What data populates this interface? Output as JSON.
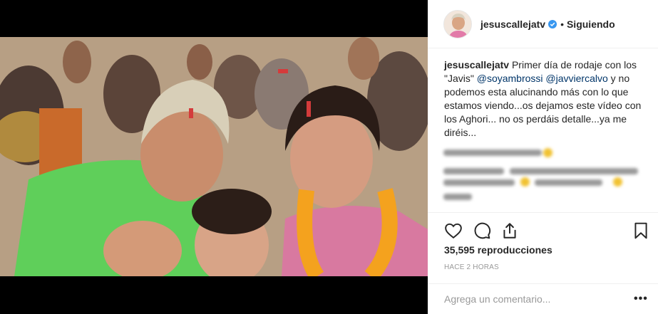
{
  "post": {
    "username": "jesuscallejatv",
    "follow_status": "Siguiendo",
    "separator": "•",
    "caption": {
      "username": "jesuscallejatv",
      "part1": " Primer día de rodaje con los \"Javis\" ",
      "mention1": "@soyambrossi",
      "mention2": "@javviercalvo",
      "part2": " y no podemos esta alucinando más con lo que estamos viendo...os dejamos este vídeo con los Aghori... no os perdáis detalle...ya me diréis..."
    },
    "views_label": "35,595 reproducciones",
    "time_label": "HACE 2 HORAS",
    "comment_placeholder": "Agrega un comentario...",
    "more_label": "•••"
  },
  "icons": {
    "verified": "verified-badge-icon",
    "like": "heart-icon",
    "comment": "comment-icon",
    "share": "share-icon",
    "save": "bookmark-icon"
  },
  "colors": {
    "verified": "#3897f0",
    "mention": "#003569",
    "muted": "#999999",
    "text": "#262626"
  }
}
